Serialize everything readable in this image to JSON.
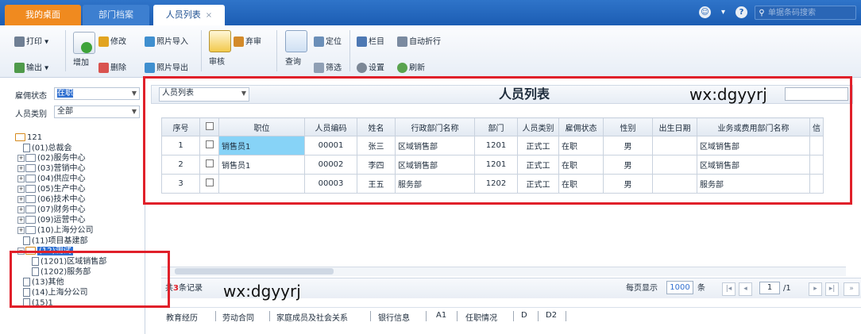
{
  "tabs": [
    {
      "label": "我的桌面"
    },
    {
      "label": "部门档案"
    },
    {
      "label": "人员列表",
      "close": "×"
    }
  ],
  "topbar": {
    "search_placeholder": "单据条码搜索",
    "icons": [
      "smiley-icon",
      "dropdown-icon",
      "help-icon",
      "search-icon"
    ]
  },
  "toolbar": {
    "print": "打印",
    "export": "输出",
    "add": "增加",
    "modify": "修改",
    "delete": "删除",
    "photo_import": "照片导入",
    "photo_export": "照片导出",
    "audit": "审核",
    "abandon": "弃审",
    "query": "查询",
    "locate": "定位",
    "filter": "筛选",
    "columns": "栏目",
    "autowrap": "自动折行",
    "settings": "设置",
    "refresh": "刷新"
  },
  "filters": {
    "employment_status_label": "雇佣状态",
    "employment_status_value": "在职",
    "person_type_label": "人员类别",
    "person_type_value": "全部"
  },
  "tree": {
    "root": "121",
    "items": [
      "(01)总裁会",
      "(02)服务中心",
      "(03)营销中心",
      "(04)供应中心",
      "(05)生产中心",
      "(06)技术中心",
      "(07)财务中心",
      "(09)运营中心",
      "(10)上海分公司",
      "(11)项目基建部",
      "(12)测试",
      "(1201)区域销售部",
      "(1202)服务部",
      "(13)其他",
      "(14)上海分公司",
      "(15)1"
    ]
  },
  "main": {
    "view_select": "人员列表",
    "title": "人员列表",
    "watermark": "wx:dgyyrj"
  },
  "grid": {
    "columns": [
      "序号",
      "",
      "职位",
      "人员编码",
      "姓名",
      "行政部门名称",
      "部门",
      "人员类别",
      "雇佣状态",
      "性别",
      "出生日期",
      "业务或费用部门名称",
      "信"
    ],
    "rows": [
      [
        "1",
        "",
        "销售员1",
        "00001",
        "张三",
        "区域销售部",
        "1201",
        "正式工",
        "在职",
        "男",
        "",
        "区域销售部",
        ""
      ],
      [
        "2",
        "",
        "销售员1",
        "00002",
        "李四",
        "区域销售部",
        "1201",
        "正式工",
        "在职",
        "男",
        "",
        "区域销售部",
        ""
      ],
      [
        "3",
        "",
        "",
        "00003",
        "王五",
        "服务部",
        "1202",
        "正式工",
        "在职",
        "男",
        "",
        "服务部",
        ""
      ]
    ]
  },
  "footer": {
    "total_prefix": "共",
    "total_count": "3",
    "total_suffix": "条记录",
    "watermark": "wx:dgyyrj",
    "per_page_label": "每页显示",
    "per_page_value": "1000",
    "per_page_unit": "条",
    "page_value": "1",
    "page_total": "/1"
  },
  "bottom_tabs": [
    "教育经历",
    "劳动合同",
    "家庭成员及社会关系",
    "银行信息",
    "A1",
    "任职情况",
    "D",
    "D2"
  ],
  "colors": {
    "accent_blue": "#1c5db3",
    "home_tab": "#f08a1f",
    "highlight_cell": "#87d3f7",
    "annotation_red": "#e0202a"
  }
}
